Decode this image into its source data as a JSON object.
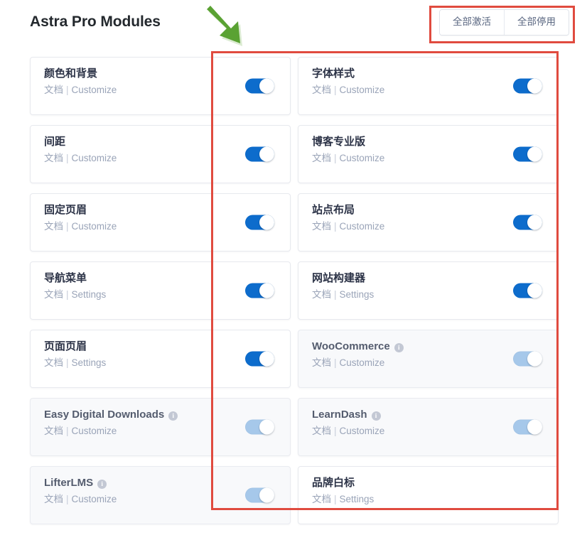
{
  "header": {
    "title": "Astra Pro Modules",
    "bulk_actions": [
      {
        "label": "全部激活",
        "name": "activate-all"
      },
      {
        "label": "全部停用",
        "name": "deactivate-all"
      }
    ]
  },
  "labels": {
    "doc": "文档",
    "separator": "|",
    "customize": "Customize",
    "settings": "Settings"
  },
  "colors": {
    "toggle_on": "#0d6ccc",
    "toggle_dim": "#a6c8ea",
    "annotation": "#e04b3f",
    "arrow": "#5aa233",
    "title": "#23282d",
    "muted_text": "#9aa4b8",
    "card_inactive_bg": "#f8f9fb"
  },
  "modules": [
    {
      "title": "颜色和背景",
      "doc": "文档",
      "action": "Customize",
      "toggle": "on",
      "info": false,
      "state": "active",
      "has_toggle": true
    },
    {
      "title": "字体样式",
      "doc": "文档",
      "action": "Customize",
      "toggle": "on",
      "info": false,
      "state": "active",
      "has_toggle": true
    },
    {
      "title": "间距",
      "doc": "文档",
      "action": "Customize",
      "toggle": "on",
      "info": false,
      "state": "active",
      "has_toggle": true
    },
    {
      "title": "博客专业版",
      "doc": "文档",
      "action": "Customize",
      "toggle": "on",
      "info": false,
      "state": "active",
      "has_toggle": true
    },
    {
      "title": "固定页眉",
      "doc": "文档",
      "action": "Customize",
      "toggle": "on",
      "info": false,
      "state": "active",
      "has_toggle": true
    },
    {
      "title": "站点布局",
      "doc": "文档",
      "action": "Customize",
      "toggle": "on",
      "info": false,
      "state": "active",
      "has_toggle": true
    },
    {
      "title": "导航菜单",
      "doc": "文档",
      "action": "Settings",
      "toggle": "on",
      "info": false,
      "state": "active",
      "has_toggle": true
    },
    {
      "title": "网站构建器",
      "doc": "文档",
      "action": "Settings",
      "toggle": "on",
      "info": false,
      "state": "active",
      "has_toggle": true
    },
    {
      "title": "页面页眉",
      "doc": "文档",
      "action": "Settings",
      "toggle": "on",
      "info": false,
      "state": "active",
      "has_toggle": true
    },
    {
      "title": "WooCommerce",
      "doc": "文档",
      "action": "Customize",
      "toggle": "dim",
      "info": true,
      "state": "inactive",
      "has_toggle": true
    },
    {
      "title": "Easy Digital Downloads",
      "doc": "文档",
      "action": "Customize",
      "toggle": "dim",
      "info": true,
      "state": "inactive",
      "has_toggle": true
    },
    {
      "title": "LearnDash",
      "doc": "文档",
      "action": "Customize",
      "toggle": "dim",
      "info": true,
      "state": "inactive",
      "has_toggle": true
    },
    {
      "title": "LifterLMS",
      "doc": "文档",
      "action": "Customize",
      "toggle": "dim",
      "info": true,
      "state": "inactive",
      "has_toggle": true
    },
    {
      "title": "品牌白标",
      "doc": "文档",
      "action": "Settings",
      "toggle": "none",
      "info": false,
      "state": "active",
      "has_toggle": false
    }
  ],
  "annotations": {
    "toggle_column_box": "red rectangle highlighting the toggle switch columns",
    "bulk_actions_box": "red rectangle highlighting the bulk action buttons",
    "arrow": "green arrow pointing down-right toward the toggle column"
  }
}
